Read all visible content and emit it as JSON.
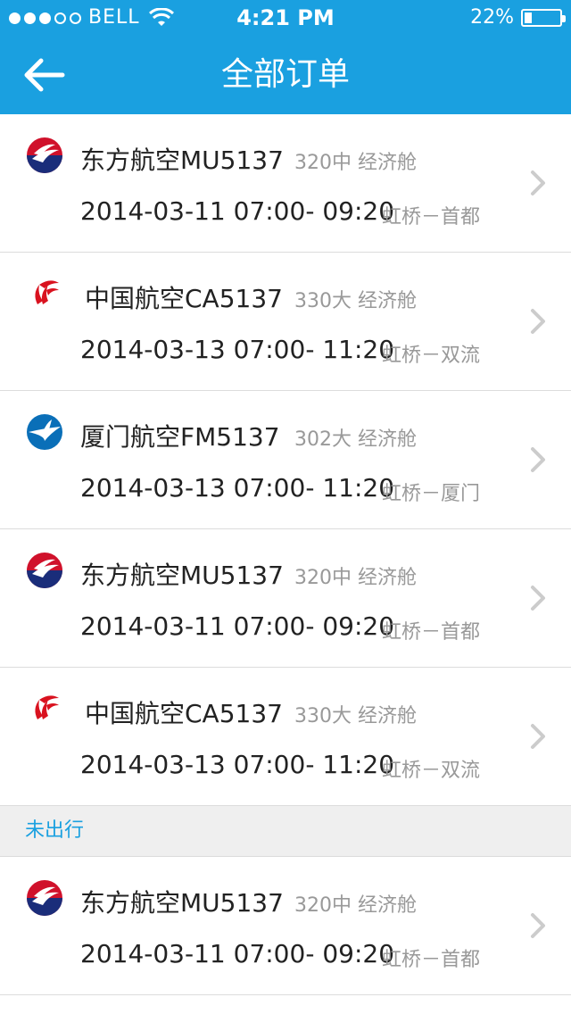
{
  "status_bar": {
    "carrier": "BELL",
    "time": "4:21 PM",
    "battery": "22%",
    "battery_level": 0.22
  },
  "nav": {
    "title": "全部订单",
    "back_icon": "arrow-left-icon"
  },
  "orders_top": [
    {
      "airline": "东方航空MU5137",
      "aircraft": "320中",
      "cabin": "经济舱",
      "date": "2014-03-11",
      "time": "07:00- 09:20",
      "route": "虹桥－首都",
      "logo": "china-eastern-logo-icon"
    },
    {
      "airline": "中国航空CA5137",
      "aircraft": "330大",
      "cabin": "经济舱",
      "date": "2014-03-13",
      "time": "07:00- 11:20",
      "route": "虹桥－双流",
      "logo": "air-china-logo-icon"
    },
    {
      "airline": "厦门航空FM5137",
      "aircraft": "302大",
      "cabin": "经济舱",
      "date": "2014-03-13",
      "time": "07:00- 11:20",
      "route": "虹桥－厦门",
      "logo": "xiamen-airlines-logo-icon"
    },
    {
      "airline": "东方航空MU5137",
      "aircraft": "320中",
      "cabin": "经济舱",
      "date": "2014-03-11",
      "time": "07:00- 09:20",
      "route": "虹桥－首都",
      "logo": "china-eastern-logo-icon"
    },
    {
      "airline": "中国航空CA5137",
      "aircraft": "330大",
      "cabin": "经济舱",
      "date": "2014-03-13",
      "time": "07:00- 11:20",
      "route": "虹桥－双流",
      "logo": "air-china-logo-icon"
    }
  ],
  "section": {
    "label": "未出行"
  },
  "orders_bottom": [
    {
      "airline": "东方航空MU5137",
      "aircraft": "320中",
      "cabin": "经济舱",
      "date": "2014-03-11",
      "time": "07:00- 09:20",
      "route": "虹桥－首都",
      "logo": "china-eastern-logo-icon"
    }
  ],
  "colors": {
    "accent": "#1aa0e0",
    "china_eastern_red": "#d0112b",
    "china_eastern_blue": "#1a2d7a",
    "air_china_red": "#d9121f",
    "xiamen_blue": "#0a6fb8"
  }
}
